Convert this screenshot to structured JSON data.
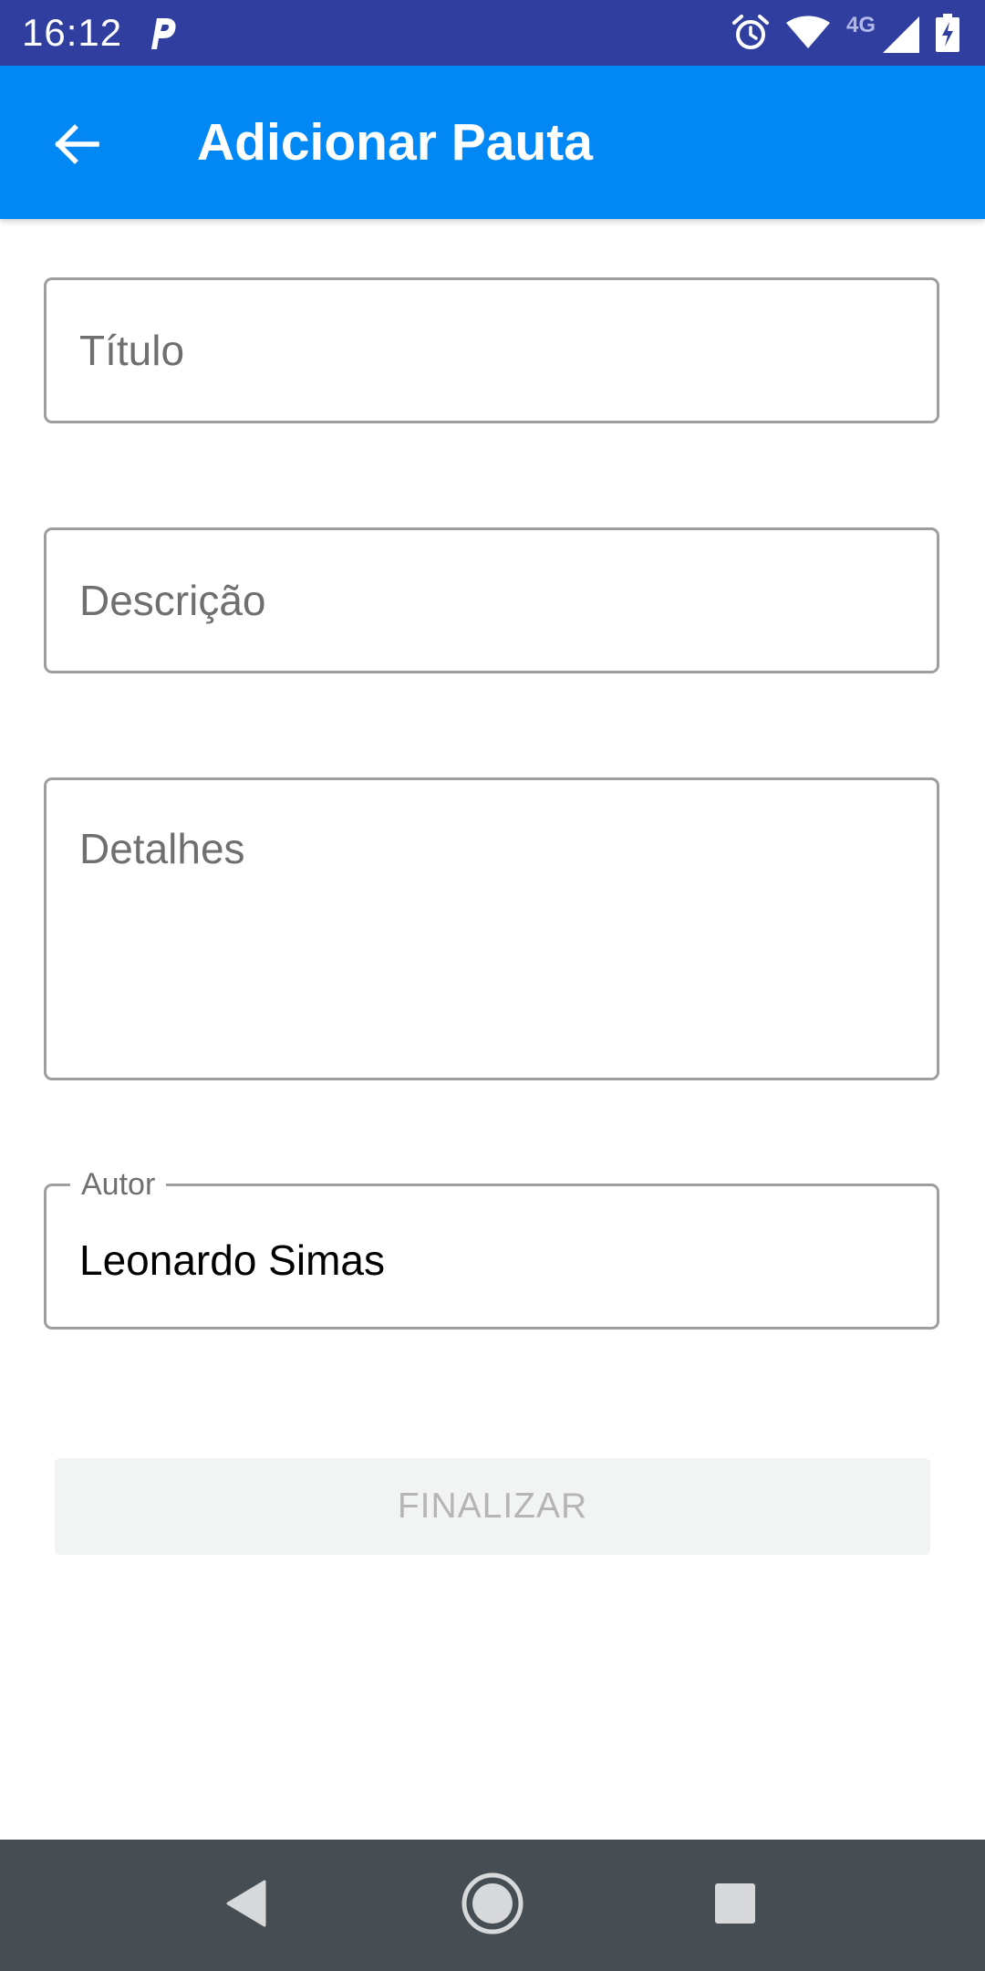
{
  "status_bar": {
    "time": "16:12",
    "network_type": "4G",
    "icons": [
      "parking-icon",
      "alarm-icon",
      "wifi-icon",
      "cellular-signal-icon",
      "battery-charging-icon"
    ]
  },
  "app_bar": {
    "title": "Adicionar Pauta",
    "back_icon": "arrow-back-icon"
  },
  "form": {
    "titulo": {
      "placeholder": "Título",
      "value": ""
    },
    "descricao": {
      "placeholder": "Descrição",
      "value": ""
    },
    "detalhes": {
      "placeholder": "Detalhes",
      "value": ""
    },
    "autor": {
      "label": "Autor",
      "value": "Leonardo Simas"
    }
  },
  "finalize_button": {
    "label": "FINALIZAR",
    "enabled": false
  },
  "nav_bar": {
    "buttons": [
      "back-triangle-icon",
      "home-circle-icon",
      "recents-square-icon"
    ]
  },
  "colors": {
    "status_bar": "#303f9f",
    "app_bar": "#0288f5",
    "field_border": "#9e9e9e",
    "button_disabled_bg": "#f2f3f3",
    "button_disabled_text": "#b5b5b5",
    "nav_bar": "#464e53"
  }
}
